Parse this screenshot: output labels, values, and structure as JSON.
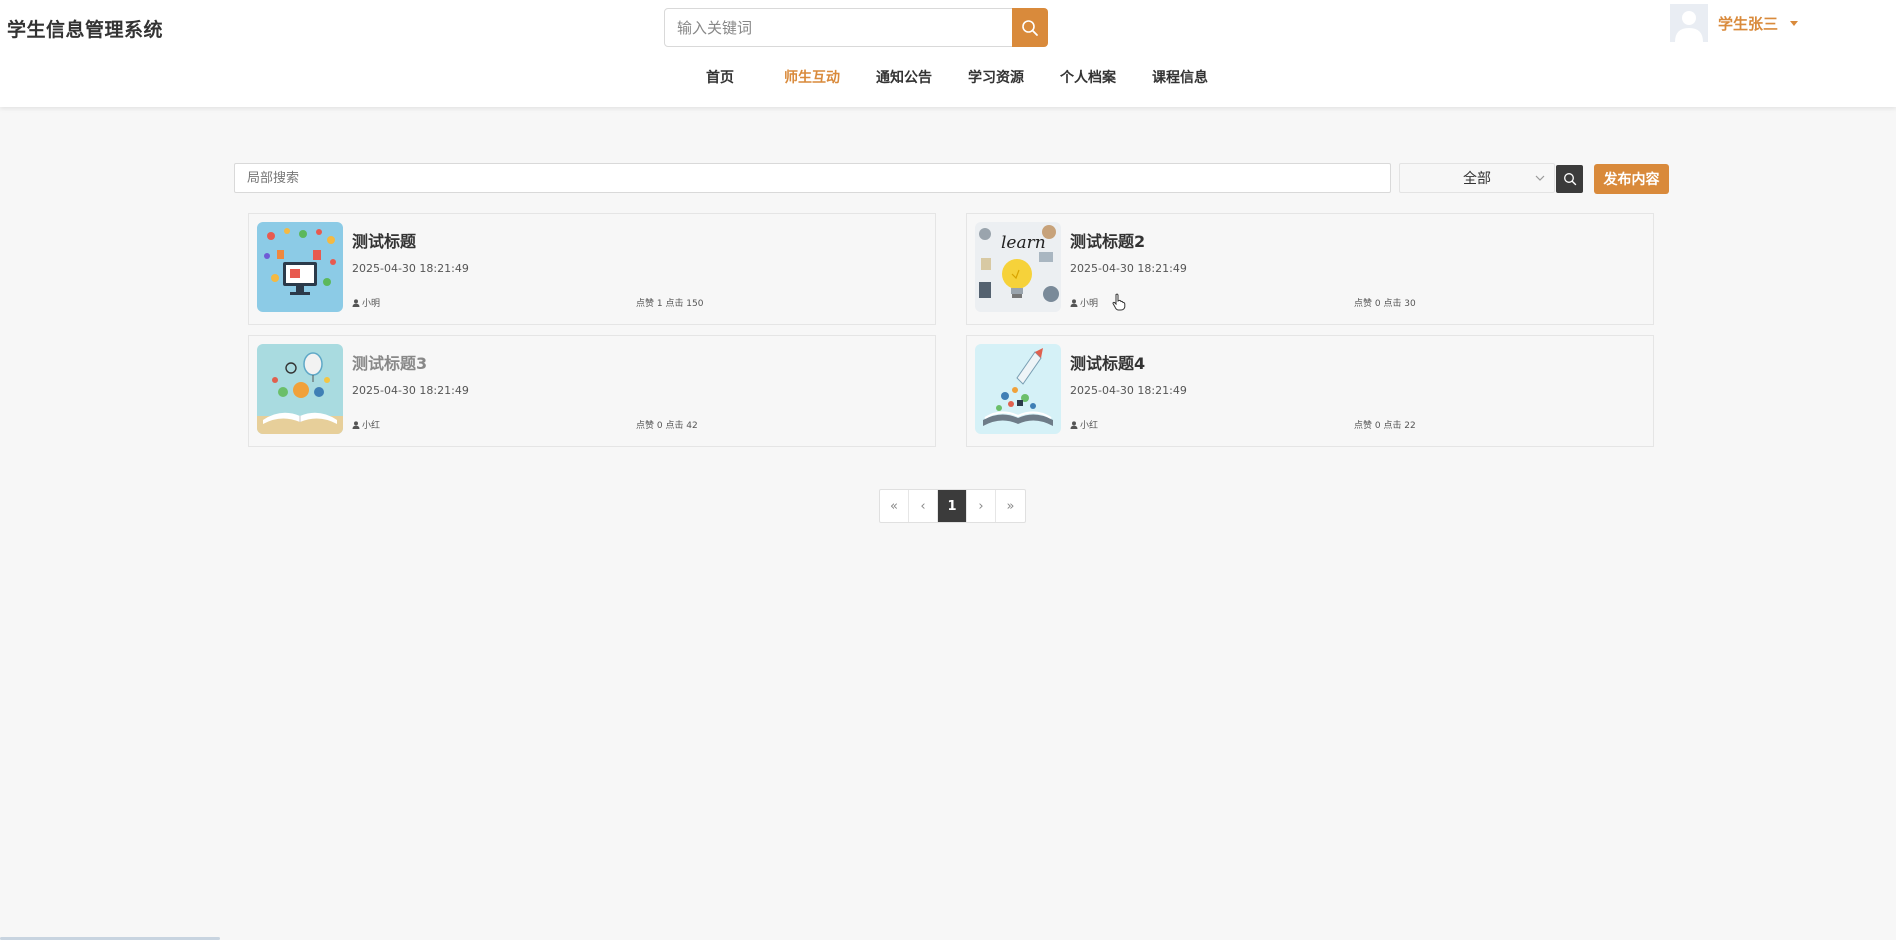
{
  "app": {
    "title": "学生信息管理系统"
  },
  "header_search": {
    "placeholder": "输入关键词",
    "icon": "search-icon"
  },
  "user": {
    "name": "学生张三",
    "avatar_icon": "avatar-placeholder"
  },
  "nav": {
    "items": [
      {
        "label": "首页",
        "active": false
      },
      {
        "label": "师生互动",
        "active": true
      },
      {
        "label": "通知公告",
        "active": false
      },
      {
        "label": "学习资源",
        "active": false
      },
      {
        "label": "个人档案",
        "active": false
      },
      {
        "label": "课程信息",
        "active": false
      }
    ]
  },
  "filters": {
    "local_search_placeholder": "局部搜索",
    "category_selected": "全部",
    "publish_label": "发布内容"
  },
  "posts": [
    {
      "title": "测试标题",
      "date": "2025-04-30 18:21:49",
      "author": "小明",
      "stats": "点赞 1 点击 150",
      "thumb": "computer-icons-illustration"
    },
    {
      "title": "测试标题2",
      "date": "2025-04-30 18:21:49",
      "author": "小明",
      "stats": "点赞 0 点击 30",
      "thumb": "learn-lightbulb-illustration"
    },
    {
      "title": "测试标题3",
      "date": "2025-04-30 18:21:49",
      "author": "小红",
      "stats": "点赞 0 点击 42",
      "thumb": "open-book-balloon-illustration"
    },
    {
      "title": "测试标题4",
      "date": "2025-04-30 18:21:49",
      "author": "小红",
      "stats": "点赞 0 点击 22",
      "thumb": "open-book-rocket-illustration"
    }
  ],
  "pagination": {
    "first": "«",
    "prev": "‹",
    "current": "1",
    "next": "›",
    "last": "»"
  },
  "colors": {
    "accent": "#d98a3b",
    "dark": "#3b3b3b",
    "background": "#f7f7f7"
  }
}
